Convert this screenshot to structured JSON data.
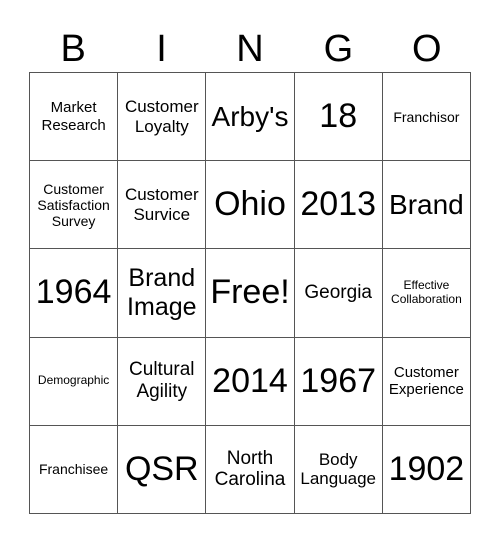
{
  "header": [
    "B",
    "I",
    "N",
    "G",
    "O"
  ],
  "cells": [
    [
      "Market Research",
      "Customer Loyalty",
      "Arby's",
      "18",
      "Franchisor"
    ],
    [
      "Customer Satisfaction Survey",
      "Customer Survice",
      "Ohio",
      "2013",
      "Brand"
    ],
    [
      "1964",
      "Brand Image",
      "Free!",
      "Georgia",
      "Effective Collaboration"
    ],
    [
      "Demographic",
      "Cultural Agility",
      "2014",
      "1967",
      "Customer Experience"
    ],
    [
      "Franchisee",
      "QSR",
      "North Carolina",
      "Body Language",
      "1902"
    ]
  ]
}
